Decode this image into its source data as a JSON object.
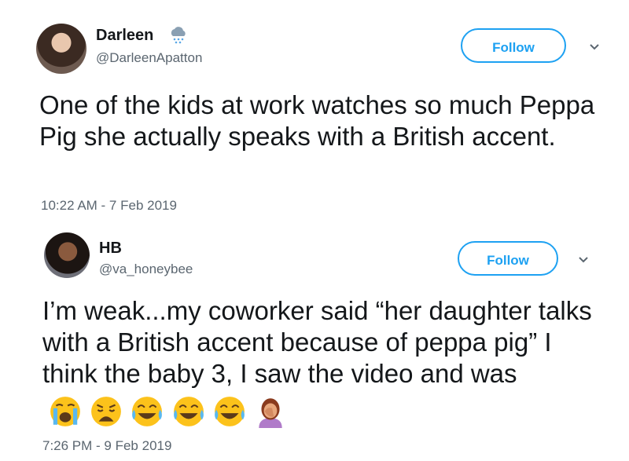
{
  "tweets": [
    {
      "name": "Darleen",
      "handle": "@DarleenApatton",
      "name_icon": "cloud-rain-icon",
      "follow_label": "Follow",
      "text": "One of the kids at work watches so much Peppa Pig she actually speaks with a British accent.",
      "time": "10:22 AM - 7 Feb 2019"
    },
    {
      "name": "HB",
      "handle": "@va_honeybee",
      "follow_label": "Follow",
      "text": "I’m weak...my coworker said “her daughter talks with a British accent because of peppa pig” I think the baby 3, I saw the video and was",
      "emojis": [
        "loudly-crying-face",
        "weary-face",
        "face-with-tears-of-joy",
        "face-with-tears-of-joy",
        "face-with-tears-of-joy",
        "person-facepalming"
      ],
      "time": "7:26 PM - 9 Feb 2019"
    }
  ],
  "colors": {
    "accent": "#1da1f2",
    "text": "#14171a",
    "muted": "#5b6670"
  }
}
